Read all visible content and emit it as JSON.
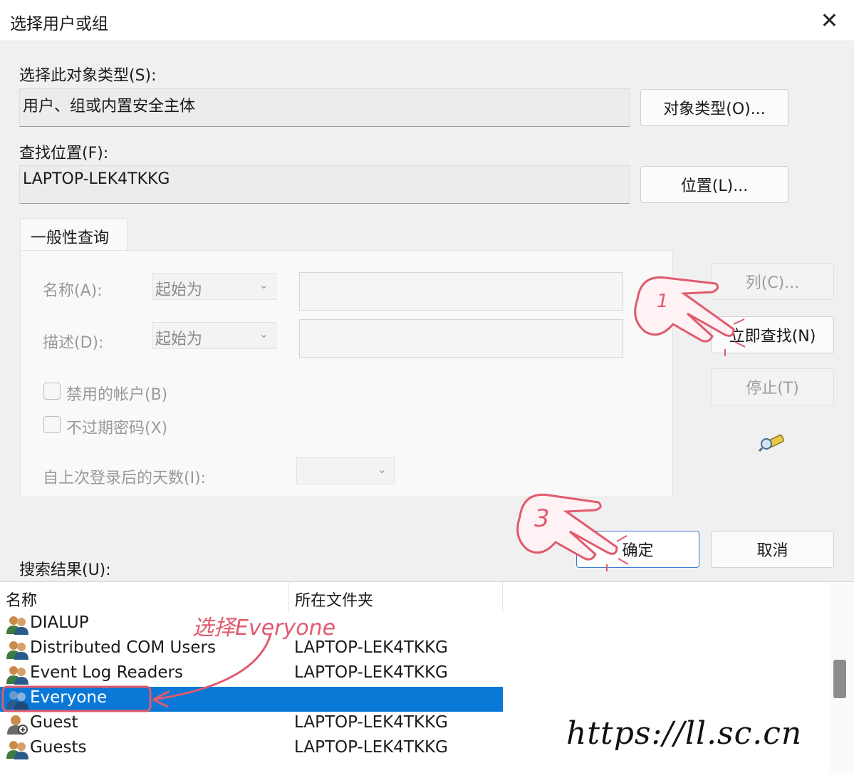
{
  "window": {
    "title": "选择用户或组",
    "close_label": "✕"
  },
  "object_type": {
    "label": "选择此对象类型(S):",
    "value": "用户、组或内置安全主体",
    "button": "对象类型(O)..."
  },
  "location": {
    "label": "查找位置(F):",
    "value": "LAPTOP-LEK4TKKG",
    "button": "位置(L)..."
  },
  "query": {
    "tab": "一般性查询",
    "name_label": "名称(A):",
    "name_mode": "起始为",
    "desc_label": "描述(D):",
    "desc_mode": "起始为",
    "disabled_accounts": "禁用的帐户(B)",
    "non_expiring": "不过期密码(X)",
    "days_label": "自上次登录后的天数(I):",
    "days_value": ""
  },
  "side_buttons": {
    "columns": "列(C)...",
    "find_now": "立即查找(N)",
    "stop": "停止(T)"
  },
  "actions": {
    "ok": "确定",
    "cancel": "取消"
  },
  "results": {
    "label": "搜索结果(U):",
    "columns": [
      "名称",
      "所在文件夹"
    ],
    "rows": [
      {
        "name": "DIALUP",
        "folder": ""
      },
      {
        "name": "Distributed COM Users",
        "folder": "LAPTOP-LEK4TKKG"
      },
      {
        "name": "Event Log Readers",
        "folder": "LAPTOP-LEK4TKKG"
      },
      {
        "name": "Everyone",
        "folder": "",
        "selected": true
      },
      {
        "name": "Guest",
        "folder": "LAPTOP-LEK4TKKG"
      },
      {
        "name": "Guests",
        "folder": "LAPTOP-LEK4TKKG"
      }
    ]
  },
  "annotations": {
    "select_note": "选择Everyone",
    "step_3": "3",
    "watermark": "https://ll.sc.cn"
  },
  "colors": {
    "selection": "#0a78d7",
    "annotation": "#e05a6e"
  },
  "icons": [
    "close-icon",
    "find-flashlight-icon",
    "group-users-icon",
    "single-user-icon",
    "chevron-down-icon"
  ]
}
